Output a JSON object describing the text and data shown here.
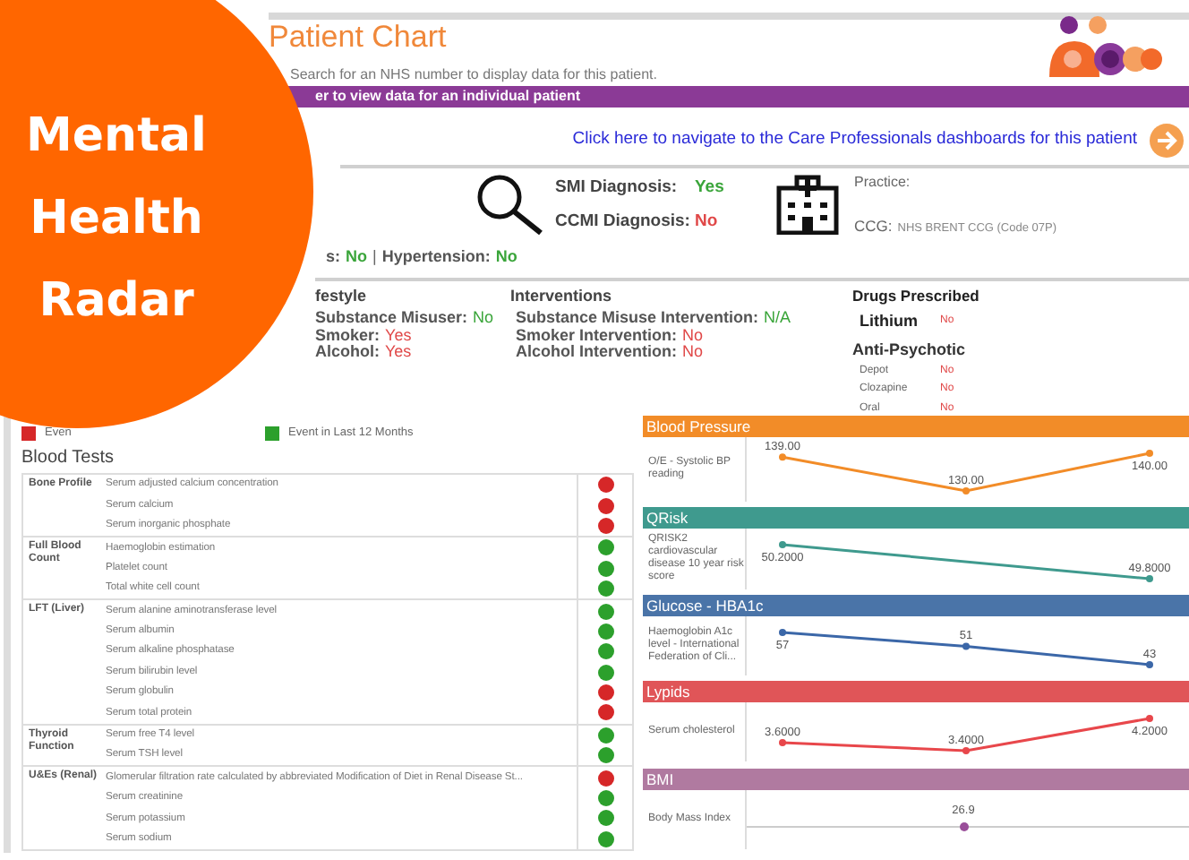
{
  "badge": {
    "lines": [
      "Mental",
      "Health",
      "Radar"
    ]
  },
  "header": {
    "title": "Patient Chart",
    "subtitle": "Search for an NHS number to display data for this patient."
  },
  "banner": "er to view data for an individual patient",
  "nav_link": "Click here to navigate to the Care Professionals dashboards for this patient",
  "diagnoses": [
    {
      "label": "SMI Diagnosis:",
      "value": "Yes",
      "color": "#3aa53a"
    },
    {
      "label": "CCMI Diagnosis:",
      "value": "No",
      "color": "#e04848"
    }
  ],
  "practice": {
    "label": "Practice:"
  },
  "ccg": {
    "label": "CCG:",
    "value": "NHS BRENT CCG (Code 07P)"
  },
  "conditions": {
    "separator": "|",
    "items": [
      {
        "label": "s:",
        "value": "No",
        "color": "#3aa53a"
      },
      {
        "label": "Hypertension:",
        "value": "No",
        "color": "#3aa53a"
      }
    ]
  },
  "lifestyle": {
    "title": "festyle",
    "items": [
      {
        "label": "Substance Misuser:",
        "value": "No",
        "color": "#3aa53a"
      },
      {
        "label": "Smoker:",
        "value": "Yes",
        "color": "#e04848"
      },
      {
        "label": "Alcohol:",
        "value": "Yes",
        "color": "#e04848"
      }
    ]
  },
  "interventions": {
    "title": "Interventions",
    "items": [
      {
        "label": "Substance Misuse Intervention:",
        "value": "N/A",
        "color": "#3aa53a"
      },
      {
        "label": "Smoker Intervention:",
        "value": "No",
        "color": "#e04848"
      },
      {
        "label": "Alcohol Intervention:",
        "value": "No",
        "color": "#e04848"
      }
    ]
  },
  "drugs": {
    "title": "Drugs Prescribed",
    "lithium": {
      "label": "Lithium",
      "value": "No"
    },
    "antipsychotic": {
      "title": "Anti-Psychotic",
      "items": [
        {
          "label": "Depot",
          "value": "No"
        },
        {
          "label": "Clozapine",
          "value": "No"
        },
        {
          "label": "Oral",
          "value": "No"
        }
      ]
    }
  },
  "legend": [
    {
      "label": "Even",
      "color": "#d62728"
    },
    {
      "label": "Event in Last 12 Months",
      "color": "#2ca02c"
    }
  ],
  "blood_tests": {
    "title": "Blood Tests",
    "groups": [
      {
        "name": "Bone Profile",
        "tests": [
          {
            "name": "Serum adjusted calcium concentration",
            "in_last_12_months": false
          },
          {
            "name": "Serum calcium",
            "in_last_12_months": false
          },
          {
            "name": "Serum inorganic phosphate",
            "in_last_12_months": false
          }
        ]
      },
      {
        "name": "Full Blood Count",
        "tests": [
          {
            "name": "Haemoglobin estimation",
            "in_last_12_months": true
          },
          {
            "name": "Platelet count",
            "in_last_12_months": true
          },
          {
            "name": "Total white cell count",
            "in_last_12_months": true
          }
        ]
      },
      {
        "name": "LFT (Liver)",
        "tests": [
          {
            "name": "Serum alanine aminotransferase level",
            "in_last_12_months": true
          },
          {
            "name": "Serum albumin",
            "in_last_12_months": true
          },
          {
            "name": "Serum alkaline phosphatase",
            "in_last_12_months": true
          },
          {
            "name": "Serum bilirubin level",
            "in_last_12_months": true
          },
          {
            "name": "Serum globulin",
            "in_last_12_months": false
          },
          {
            "name": "Serum total protein",
            "in_last_12_months": false
          }
        ]
      },
      {
        "name": "Thyroid Function",
        "tests": [
          {
            "name": "Serum free T4 level",
            "in_last_12_months": true
          },
          {
            "name": "Serum TSH level",
            "in_last_12_months": true
          }
        ]
      },
      {
        "name": "U&Es (Renal)",
        "tests": [
          {
            "name": "Glomerular filtration rate calculated by abbreviated Modification of Diet in Renal Disease St...",
            "in_last_12_months": false
          },
          {
            "name": "Serum creatinine",
            "in_last_12_months": true
          },
          {
            "name": "Serum potassium",
            "in_last_12_months": true
          },
          {
            "name": "Serum sodium",
            "in_last_12_months": true
          }
        ]
      }
    ]
  },
  "charts": [
    {
      "title": "Blood Pressure",
      "color": "#f28c28",
      "chart_data": {
        "type": "line",
        "categories": [
          null,
          null,
          null
        ],
        "series": [
          {
            "name": "O/E - Systolic BP reading",
            "color": "#f28c28",
            "marker": "circle",
            "values": [
              139,
              130,
              140
            ],
            "value_labels": [
              "139.00",
              "130.00",
              "140.00"
            ]
          }
        ],
        "data_labels": true
      }
    },
    {
      "title": "QRisk",
      "color": "#3f9a8e",
      "chart_data": {
        "type": "line",
        "categories": [
          null,
          null
        ],
        "series": [
          {
            "name": "QRISK2 cardiovascular disease 10 year risk score",
            "color": "#3f9a8e",
            "marker": "circle",
            "values": [
              50.2,
              49.8
            ],
            "value_labels": [
              "50.2000",
              "49.8000"
            ]
          }
        ],
        "data_labels": true
      }
    },
    {
      "title": "Glucose - HBA1c",
      "color": "#4a74a8",
      "chart_data": {
        "type": "line",
        "categories": [
          null,
          null,
          null
        ],
        "series": [
          {
            "name": "Haemoglobin A1c level - International Federation of Cli...",
            "color": "#3b67a8",
            "marker": "circle",
            "values": [
              57,
              51,
              43
            ],
            "value_labels": [
              "57",
              "51",
              "43"
            ]
          }
        ],
        "data_labels": true
      }
    },
    {
      "title": "Lypids",
      "color": "#e05558",
      "chart_data": {
        "type": "line",
        "categories": [
          null,
          null,
          null
        ],
        "series": [
          {
            "name": "Serum cholesterol",
            "color": "#e8474b",
            "marker": "circle",
            "values": [
              3.6,
              3.4,
              4.2
            ],
            "value_labels": [
              "3.6000",
              "3.4000",
              "4.2000"
            ]
          }
        ],
        "data_labels": true
      }
    },
    {
      "title": "BMI",
      "color": "#b07aa0",
      "series_name": "Body Mass Index",
      "reading": "26.9"
    }
  ]
}
